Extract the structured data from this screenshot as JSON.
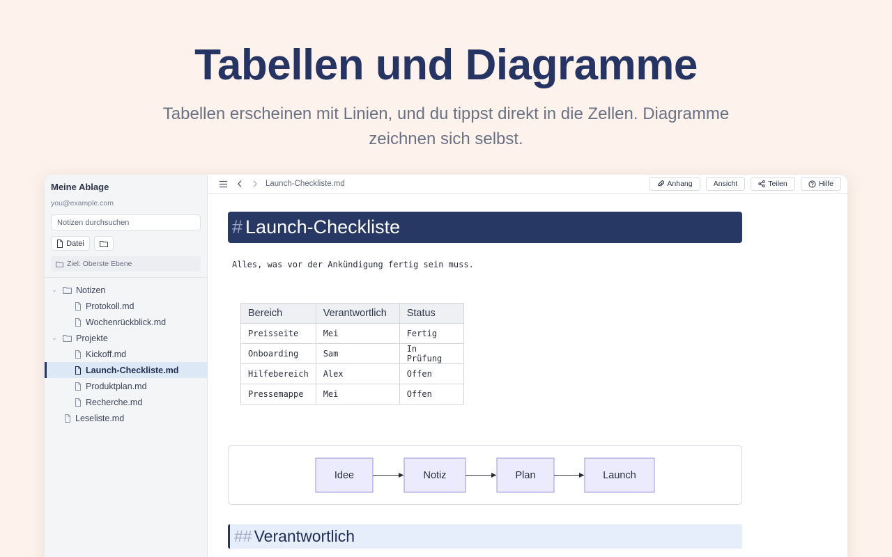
{
  "hero": {
    "title": "Tabellen und Diagramme",
    "subtitle": "Tabellen erscheinen mit Linien, und du tippst direkt in die Zellen. Diagramme zeichnen sich selbst."
  },
  "sidebar": {
    "title": "Meine Ablage",
    "email": "you@example.com",
    "search_placeholder": "Notizen durchsuchen",
    "new_file_label": "Datei",
    "target_label": "Ziel: Oberste Ebene",
    "tree": [
      {
        "label": "Notizen",
        "type": "folder",
        "expanded": true
      },
      {
        "label": "Protokoll.md",
        "type": "file"
      },
      {
        "label": "Wochenrückblick.md",
        "type": "file"
      },
      {
        "label": "Projekte",
        "type": "folder",
        "expanded": true
      },
      {
        "label": "Kickoff.md",
        "type": "file"
      },
      {
        "label": "Launch-Checkliste.md",
        "type": "file",
        "active": true
      },
      {
        "label": "Produktplan.md",
        "type": "file"
      },
      {
        "label": "Recherche.md",
        "type": "file"
      },
      {
        "label": "Leseliste.md",
        "type": "file"
      }
    ]
  },
  "toolbar": {
    "path": "Launch-Checkliste.md",
    "attachment_label": "Anhang",
    "view_label": "Ansicht",
    "share_label": "Teilen",
    "help_label": "Hilfe"
  },
  "document": {
    "h1_hash": "#",
    "h1": "Launch-Checkliste",
    "paragraph": "Alles, was vor der Ankündigung fertig sein muss.",
    "table": {
      "headers": [
        "Bereich",
        "Verantwortlich",
        "Status"
      ],
      "rows": [
        [
          "Preisseite",
          "Mei",
          "Fertig"
        ],
        [
          "Onboarding",
          "Sam",
          "In Prüfung"
        ],
        [
          "Hilfebereich",
          "Alex",
          "Offen"
        ],
        [
          "Pressemappe",
          "Mei",
          "Offen"
        ]
      ]
    },
    "diagram": {
      "nodes": [
        "Idee",
        "Notiz",
        "Plan",
        "Launch"
      ]
    },
    "h2_hash": "##",
    "h2": "Verantwortlich"
  },
  "colors": {
    "accent": "#283864",
    "background": "#fdf3ec",
    "node_fill": "#ecebfd",
    "node_border": "#9b93dd"
  }
}
